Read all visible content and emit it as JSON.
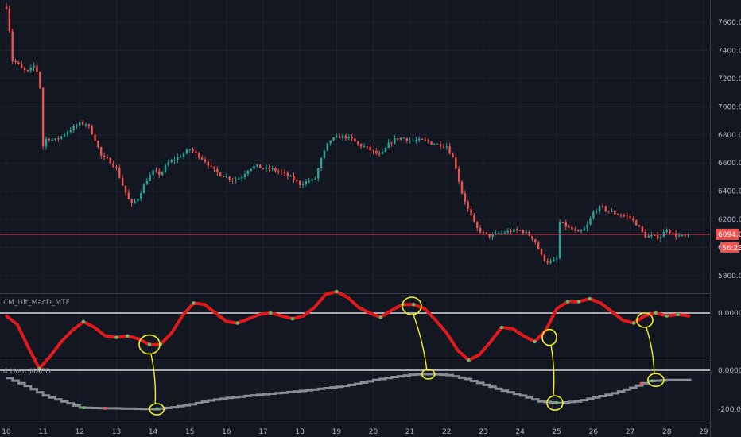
{
  "colors": {
    "background": "#131722",
    "grid": "#1e222d",
    "up": "#26a69a",
    "down": "#ef5350",
    "price_line": "#f06075",
    "macd_line": "#e0191c",
    "signal_up": "#66bb6a",
    "hist_line": "#8a8d95",
    "annotation": "#f2f21a"
  },
  "chart_data": [
    {
      "type": "candlestick",
      "title": "",
      "ylim": [
        5750,
        7750
      ],
      "y_ticks": [
        "7600.00",
        "7400.00",
        "7200.00",
        "7000.00",
        "6800.00",
        "6600.00",
        "6400.00",
        "6200.00",
        "6000.00",
        "5800.00"
      ],
      "x_ticks": [
        "10",
        "11",
        "12",
        "13",
        "14",
        "15",
        "16",
        "17",
        "18",
        "19",
        "20",
        "21",
        "22",
        "23",
        "24",
        "25",
        "26",
        "27",
        "28",
        "29"
      ],
      "close_path": [
        [
          10.0,
          7710
        ],
        [
          10.05,
          7650
        ],
        [
          10.15,
          7330
        ],
        [
          10.3,
          7310
        ],
        [
          10.45,
          7260
        ],
        [
          10.6,
          7250
        ],
        [
          10.75,
          7290
        ],
        [
          10.9,
          7220
        ],
        [
          11.0,
          6720
        ],
        [
          11.1,
          6780
        ],
        [
          11.3,
          6760
        ],
        [
          11.5,
          6790
        ],
        [
          11.7,
          6830
        ],
        [
          12.0,
          6880
        ],
        [
          12.2,
          6880
        ],
        [
          12.4,
          6780
        ],
        [
          12.6,
          6640
        ],
        [
          12.8,
          6620
        ],
        [
          13.0,
          6560
        ],
        [
          13.2,
          6420
        ],
        [
          13.4,
          6300
        ],
        [
          13.6,
          6360
        ],
        [
          13.8,
          6470
        ],
        [
          14.0,
          6540
        ],
        [
          14.2,
          6520
        ],
        [
          14.4,
          6600
        ],
        [
          14.6,
          6630
        ],
        [
          14.8,
          6660
        ],
        [
          15.0,
          6700
        ],
        [
          15.2,
          6660
        ],
        [
          15.4,
          6620
        ],
        [
          15.6,
          6560
        ],
        [
          15.8,
          6520
        ],
        [
          16.0,
          6500
        ],
        [
          16.2,
          6480
        ],
        [
          16.4,
          6500
        ],
        [
          16.6,
          6560
        ],
        [
          16.8,
          6580
        ],
        [
          17.0,
          6560
        ],
        [
          17.2,
          6560
        ],
        [
          17.4,
          6540
        ],
        [
          17.6,
          6520
        ],
        [
          17.8,
          6490
        ],
        [
          18.0,
          6450
        ],
        [
          18.2,
          6470
        ],
        [
          18.4,
          6480
        ],
        [
          18.6,
          6640
        ],
        [
          18.8,
          6760
        ],
        [
          19.0,
          6780
        ],
        [
          19.2,
          6790
        ],
        [
          19.4,
          6770
        ],
        [
          19.6,
          6730
        ],
        [
          19.8,
          6710
        ],
        [
          20.0,
          6680
        ],
        [
          20.2,
          6650
        ],
        [
          20.4,
          6730
        ],
        [
          20.6,
          6770
        ],
        [
          20.8,
          6780
        ],
        [
          21.0,
          6760
        ],
        [
          21.2,
          6760
        ],
        [
          21.4,
          6760
        ],
        [
          21.6,
          6740
        ],
        [
          21.8,
          6730
        ],
        [
          22.0,
          6720
        ],
        [
          22.2,
          6620
        ],
        [
          22.4,
          6400
        ],
        [
          22.6,
          6260
        ],
        [
          22.8,
          6140
        ],
        [
          23.0,
          6100
        ],
        [
          23.2,
          6080
        ],
        [
          23.4,
          6100
        ],
        [
          23.6,
          6110
        ],
        [
          23.8,
          6120
        ],
        [
          24.0,
          6120
        ],
        [
          24.2,
          6100
        ],
        [
          24.4,
          6050
        ],
        [
          24.6,
          5930
        ],
        [
          24.8,
          5890
        ],
        [
          25.0,
          5920
        ],
        [
          25.05,
          6180
        ],
        [
          25.2,
          6160
        ],
        [
          25.4,
          6130
        ],
        [
          25.6,
          6100
        ],
        [
          25.8,
          6140
        ],
        [
          26.0,
          6250
        ],
        [
          26.2,
          6290
        ],
        [
          26.4,
          6260
        ],
        [
          26.6,
          6240
        ],
        [
          26.8,
          6230
        ],
        [
          27.0,
          6210
        ],
        [
          27.2,
          6160
        ],
        [
          27.4,
          6080
        ],
        [
          27.6,
          6080
        ],
        [
          27.8,
          6070
        ],
        [
          28.0,
          6130
        ],
        [
          28.2,
          6090
        ],
        [
          28.4,
          6080
        ],
        [
          28.6,
          6080
        ]
      ],
      "current_price_line": 6094.03,
      "price_label": "6094.03",
      "second_label_partial": "60",
      "countdown_label": "56:23"
    },
    {
      "type": "line",
      "title": "CM_Ult_MacD_MTF",
      "ylim": [
        -260,
        110
      ],
      "y_ticks": [
        "0.0000"
      ],
      "zero_line": 0,
      "series": [
        {
          "values": [
            [
              10.0,
              -10
            ],
            [
              10.3,
              -40
            ],
            [
              10.6,
              -120
            ],
            [
              10.9,
              -195
            ],
            [
              11.2,
              -150
            ],
            [
              11.5,
              -100
            ],
            [
              11.8,
              -60
            ],
            [
              12.1,
              -30
            ],
            [
              12.4,
              -50
            ],
            [
              12.7,
              -80
            ],
            [
              13.0,
              -85
            ],
            [
              13.3,
              -80
            ],
            [
              13.6,
              -90
            ],
            [
              13.9,
              -110
            ],
            [
              14.2,
              -110
            ],
            [
              14.5,
              -70
            ],
            [
              14.8,
              -10
            ],
            [
              15.1,
              35
            ],
            [
              15.4,
              30
            ],
            [
              15.7,
              0
            ],
            [
              16.0,
              -30
            ],
            [
              16.3,
              -35
            ],
            [
              16.6,
              -20
            ],
            [
              16.9,
              -5
            ],
            [
              17.2,
              0
            ],
            [
              17.5,
              -10
            ],
            [
              17.8,
              -20
            ],
            [
              18.1,
              -10
            ],
            [
              18.4,
              20
            ],
            [
              18.7,
              65
            ],
            [
              19.0,
              75
            ],
            [
              19.3,
              55
            ],
            [
              19.6,
              20
            ],
            [
              19.9,
              0
            ],
            [
              20.2,
              -15
            ],
            [
              20.5,
              10
            ],
            [
              20.8,
              30
            ],
            [
              21.1,
              30
            ],
            [
              21.4,
              15
            ],
            [
              21.7,
              -25
            ],
            [
              22.0,
              -70
            ],
            [
              22.3,
              -130
            ],
            [
              22.6,
              -165
            ],
            [
              22.9,
              -145
            ],
            [
              23.2,
              -100
            ],
            [
              23.5,
              -50
            ],
            [
              23.8,
              -55
            ],
            [
              24.1,
              -80
            ],
            [
              24.4,
              -100
            ],
            [
              24.7,
              -60
            ],
            [
              25.0,
              15
            ],
            [
              25.3,
              40
            ],
            [
              25.6,
              40
            ],
            [
              25.9,
              50
            ],
            [
              26.2,
              35
            ],
            [
              26.5,
              5
            ],
            [
              26.8,
              -25
            ],
            [
              27.1,
              -35
            ],
            [
              27.4,
              -10
            ],
            [
              27.7,
              0
            ],
            [
              28.0,
              -10
            ],
            [
              28.3,
              -5
            ],
            [
              28.6,
              -10
            ]
          ]
        }
      ]
    },
    {
      "type": "line",
      "title": "4 Hour MACD",
      "ylim": [
        -240,
        30
      ],
      "y_ticks": [
        "0.0000",
        "-200.0000"
      ],
      "zero_line": 0,
      "series": [
        {
          "values": [
            [
              10.0,
              -40
            ],
            [
              10.5,
              -80
            ],
            [
              11.0,
              -130
            ],
            [
              11.5,
              -160
            ],
            [
              12.0,
              -192
            ],
            [
              12.5,
              -195
            ],
            [
              13.0,
              -196
            ],
            [
              13.5,
              -198
            ],
            [
              14.0,
              -200
            ],
            [
              14.5,
              -190
            ],
            [
              15.0,
              -175
            ],
            [
              15.5,
              -155
            ],
            [
              16.0,
              -142
            ],
            [
              16.5,
              -132
            ],
            [
              17.0,
              -123
            ],
            [
              17.5,
              -115
            ],
            [
              18.0,
              -106
            ],
            [
              18.5,
              -95
            ],
            [
              19.0,
              -85
            ],
            [
              19.5,
              -70
            ],
            [
              20.0,
              -50
            ],
            [
              20.5,
              -35
            ],
            [
              21.0,
              -23
            ],
            [
              21.4,
              -20
            ],
            [
              21.6,
              -20
            ],
            [
              22.0,
              -25
            ],
            [
              22.5,
              -45
            ],
            [
              23.0,
              -75
            ],
            [
              23.5,
              -105
            ],
            [
              24.0,
              -130
            ],
            [
              24.5,
              -160
            ],
            [
              25.0,
              -168
            ],
            [
              25.5,
              -160
            ],
            [
              26.0,
              -140
            ],
            [
              26.5,
              -118
            ],
            [
              27.0,
              -90
            ],
            [
              27.5,
              -55
            ],
            [
              28.0,
              -50
            ],
            [
              28.5,
              -50
            ],
            [
              28.8,
              -50
            ]
          ]
        }
      ]
    }
  ]
}
